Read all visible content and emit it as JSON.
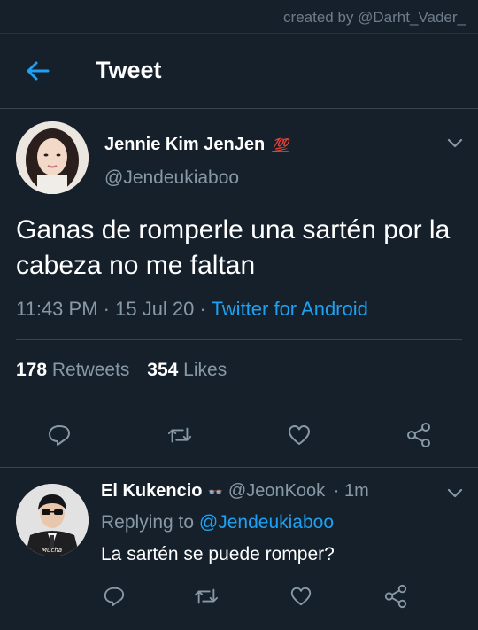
{
  "watermark": "created by @Darht_Vader_",
  "header": {
    "title": "Tweet"
  },
  "tweet": {
    "display_name": "Jennie Kim JenJen",
    "badge": "💯",
    "handle": "@Jendeukiaboo",
    "text": "Ganas de romperle una sartén por la cabeza no me faltan",
    "time": "11:43 PM",
    "date": "15 Jul 20",
    "source": "Twitter for Android",
    "retweets_count": "178",
    "retweets_label": "Retweets",
    "likes_count": "354",
    "likes_label": "Likes"
  },
  "reply": {
    "display_name": "El Kukencio",
    "badge": "👓",
    "handle": "@JeonKook",
    "age": "1m",
    "replying_to_label": "Replying to",
    "replying_to_handle": "@Jendeukiaboo",
    "text": "La sartén se puede romper?",
    "avatar_caption": "Mucha"
  },
  "colors": {
    "background": "#15202b",
    "accent": "#1da1f2",
    "secondary_text": "#8899a6",
    "divider": "#38444d"
  },
  "icons": [
    "back-arrow-icon",
    "chevron-down-icon",
    "reply-icon",
    "retweet-icon",
    "like-icon",
    "share-icon"
  ]
}
